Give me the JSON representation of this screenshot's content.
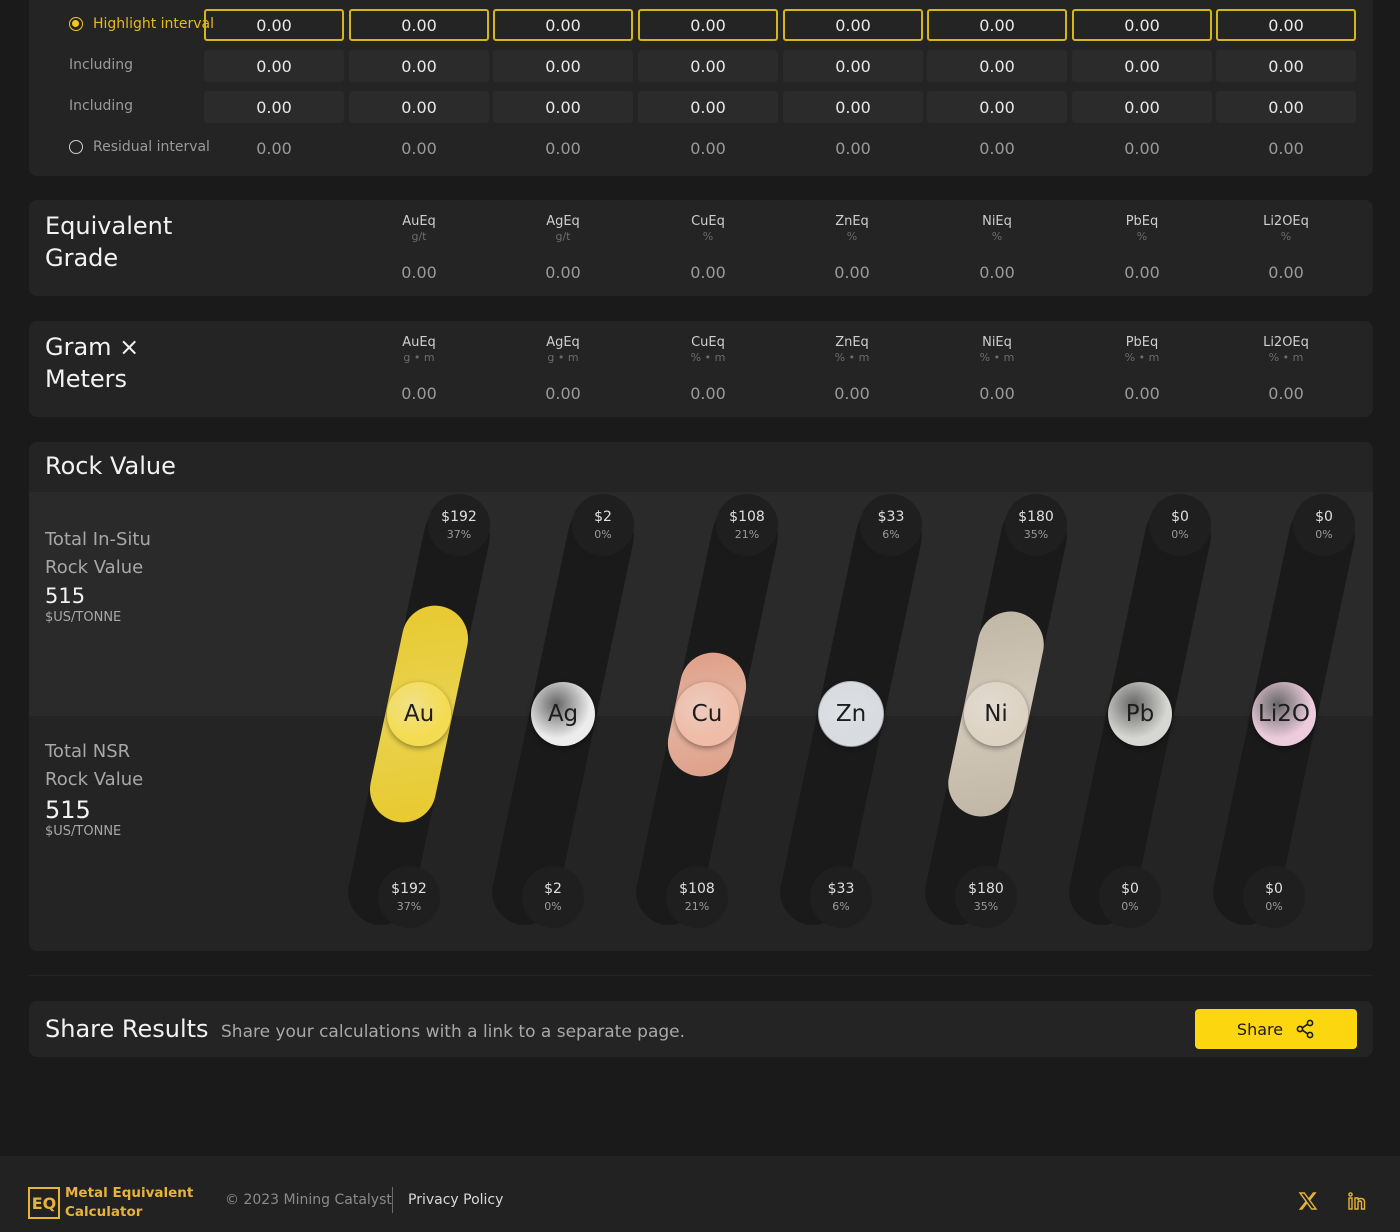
{
  "intervals": {
    "rows": [
      {
        "label": "Highlight interval",
        "kind": "hl",
        "radio": "on",
        "values": [
          "0.00",
          "0.00",
          "0.00",
          "0.00",
          "0.00",
          "0.00",
          "0.00",
          "0.00"
        ]
      },
      {
        "label": "Including",
        "kind": "sub",
        "radio": "",
        "values": [
          "0.00",
          "0.00",
          "0.00",
          "0.00",
          "0.00",
          "0.00",
          "0.00",
          "0.00"
        ]
      },
      {
        "label": "Including",
        "kind": "sub",
        "radio": "",
        "values": [
          "0.00",
          "0.00",
          "0.00",
          "0.00",
          "0.00",
          "0.00",
          "0.00",
          "0.00"
        ]
      },
      {
        "label": "Residual interval",
        "kind": "res",
        "radio": "off",
        "values": [
          "0.00",
          "0.00",
          "0.00",
          "0.00",
          "0.00",
          "0.00",
          "0.00",
          "0.00"
        ]
      }
    ]
  },
  "equivalent_grade": {
    "title_line1": "Equivalent",
    "title_line2": "Grade",
    "columns": [
      {
        "name": "AuEq",
        "unit": "g/t",
        "value": "0.00"
      },
      {
        "name": "AgEq",
        "unit": "g/t",
        "value": "0.00"
      },
      {
        "name": "CuEq",
        "unit": "%",
        "value": "0.00"
      },
      {
        "name": "ZnEq",
        "unit": "%",
        "value": "0.00"
      },
      {
        "name": "NiEq",
        "unit": "%",
        "value": "0.00"
      },
      {
        "name": "PbEq",
        "unit": "%",
        "value": "0.00"
      },
      {
        "name": "Li2OEq",
        "unit": "%",
        "value": "0.00"
      }
    ]
  },
  "gram_meters": {
    "title_line1": "Gram ×",
    "title_line2": "Meters",
    "columns": [
      {
        "name": "AuEq",
        "unit": "g • m",
        "value": "0.00"
      },
      {
        "name": "AgEq",
        "unit": "g • m",
        "value": "0.00"
      },
      {
        "name": "CuEq",
        "unit": "% • m",
        "value": "0.00"
      },
      {
        "name": "ZnEq",
        "unit": "% • m",
        "value": "0.00"
      },
      {
        "name": "NiEq",
        "unit": "% • m",
        "value": "0.00"
      },
      {
        "name": "PbEq",
        "unit": "% • m",
        "value": "0.00"
      },
      {
        "name": "Li2OEq",
        "unit": "% • m",
        "value": "0.00"
      }
    ]
  },
  "rock_value": {
    "title": "Rock Value",
    "insitu_line1": "Total In-Situ",
    "insitu_line2": "Rock Value",
    "insitu_value": "515",
    "insitu_unit": "$US/TONNE",
    "nsr_line1": "Total NSR",
    "nsr_line2": "Rock Value",
    "nsr_value": "515",
    "nsr_unit": "$US/TONNE",
    "metals": [
      {
        "symbol": "Au",
        "top_value": "$192",
        "top_pct": "37%",
        "bottom_value": "$192",
        "bottom_pct": "37%",
        "share": 0.37,
        "color": "#f2d22e",
        "ball": "#f4dc52"
      },
      {
        "symbol": "Ag",
        "top_value": "$2",
        "top_pct": "0%",
        "bottom_value": "$2",
        "bottom_pct": "0%",
        "share": 0.0,
        "color": "#dedede",
        "ball": "#ececec"
      },
      {
        "symbol": "Cu",
        "top_value": "$108",
        "top_pct": "21%",
        "bottom_value": "$108",
        "bottom_pct": "21%",
        "share": 0.21,
        "color": "#e8a58c",
        "ball": "#efbca8"
      },
      {
        "symbol": "Zn",
        "top_value": "$33",
        "top_pct": "6%",
        "bottom_value": "$33",
        "bottom_pct": "6%",
        "share": 0.06,
        "color": "#c6ccd3",
        "ball": "#d8dce1"
      },
      {
        "symbol": "Ni",
        "top_value": "$180",
        "top_pct": "35%",
        "bottom_value": "$180",
        "bottom_pct": "35%",
        "share": 0.35,
        "color": "#c9beac",
        "ball": "#ddd3c3"
      },
      {
        "symbol": "Pb",
        "top_value": "$0",
        "top_pct": "0%",
        "bottom_value": "$0",
        "bottom_pct": "0%",
        "share": 0.0,
        "color": "#cfcfcb",
        "ball": "#d6d6d2"
      },
      {
        "symbol": "Li2O",
        "top_value": "$0",
        "top_pct": "0%",
        "bottom_value": "$0",
        "bottom_pct": "0%",
        "share": 0.0,
        "color": "#e8c2d4",
        "ball": "#ecccdc"
      }
    ]
  },
  "share": {
    "title": "Share Results",
    "description": "Share your calculations with a link to a separate page.",
    "button_label": "Share"
  },
  "footer": {
    "logo_mark": "EQ",
    "logo_line1": "Metal Equivalent",
    "logo_line2": "Calculator",
    "copyright": "© 2023 Mining Catalyst",
    "privacy_label": "Privacy Policy"
  },
  "colors": {
    "accent": "#fcd60f",
    "logo": "#e8b33a"
  }
}
